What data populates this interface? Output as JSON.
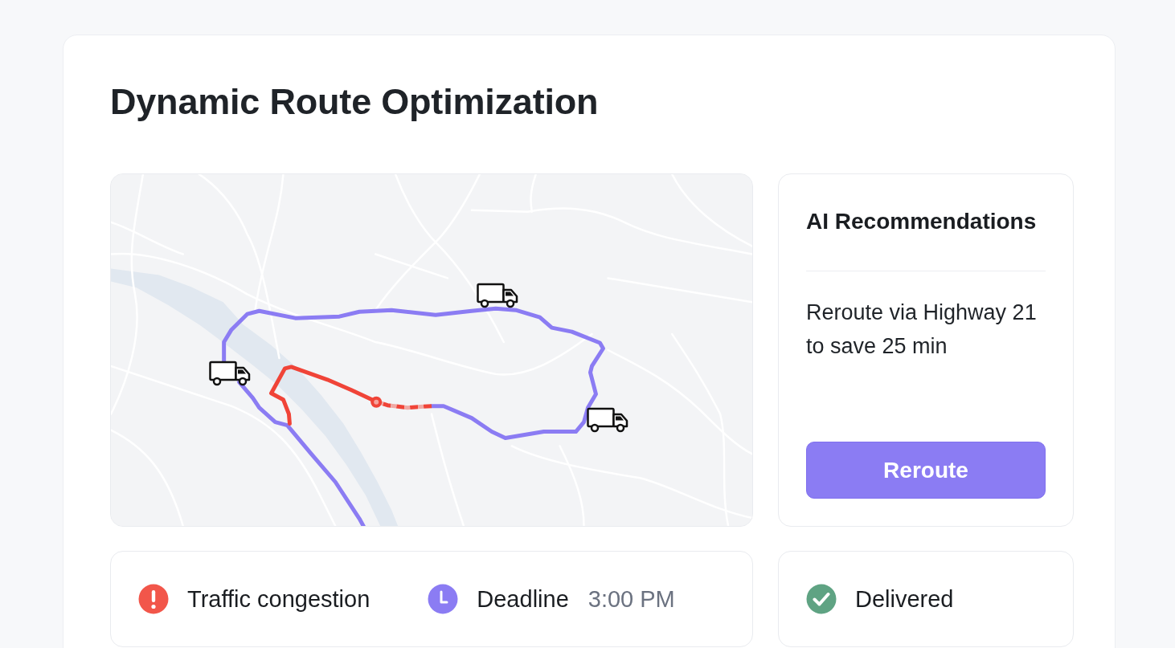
{
  "title": "Dynamic Route Optimization",
  "recommendations": {
    "title": "AI Recommendations",
    "message": "Reroute via Highway 21 to save 25 min",
    "button": "Reroute"
  },
  "alerts": [
    {
      "kind": "warning",
      "label": "Traffic congestion"
    },
    {
      "kind": "deadline",
      "label": "Deadline",
      "value": "3:00 PM"
    }
  ],
  "status": {
    "kind": "success",
    "label": "Delivered"
  }
}
